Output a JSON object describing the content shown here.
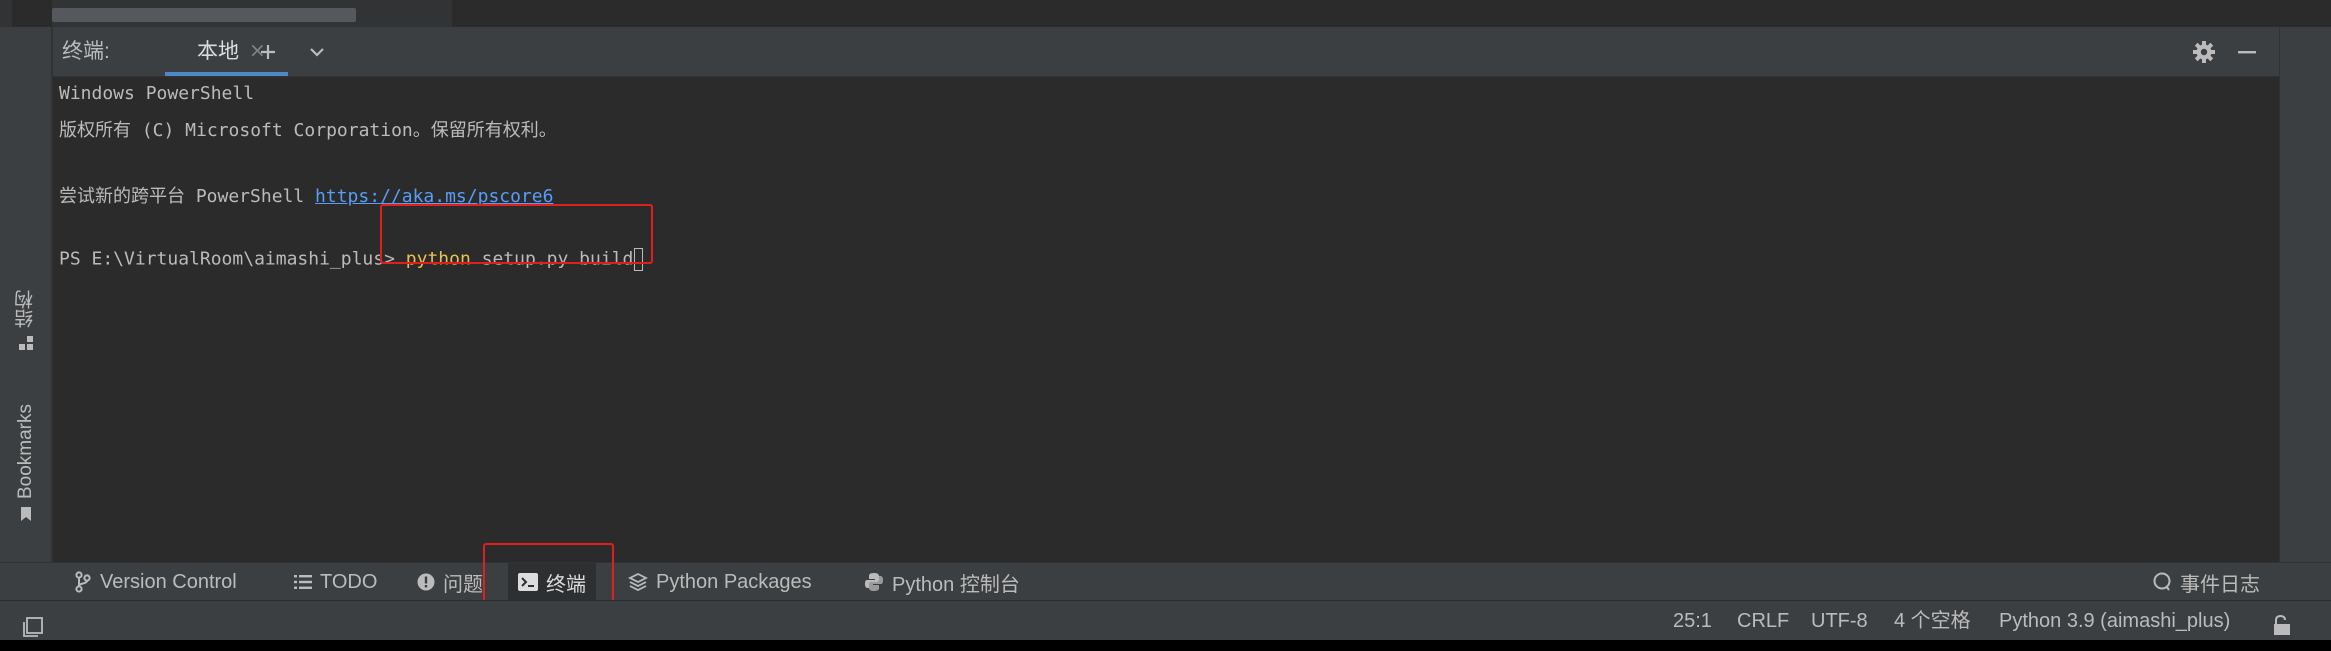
{
  "terminal": {
    "title": "终端:",
    "tab_label": "本地",
    "tab_close": "×",
    "lines": {
      "l1": "Windows PowerShell",
      "l2": "版权所有 (C) Microsoft Corporation。保留所有权利。",
      "l3_prefix": "尝试新的跨平台 PowerShell ",
      "l3_link": "https://aka.ms/pscore6",
      "prompt": "PS E:\\VirtualRoom\\aimashi_plus> ",
      "cmd_keyword": "python",
      "cmd_rest": " setup.py build"
    }
  },
  "left_stripe": {
    "structure_label": "结构",
    "bookmarks_label": "Bookmarks"
  },
  "tool_windows": {
    "version_control": "Version Control",
    "todo": "TODO",
    "problems": "问题",
    "terminal": "终端",
    "python_packages": "Python Packages",
    "python_console": "Python 控制台",
    "event_log": "事件日志"
  },
  "status": {
    "position": "25:1",
    "line_sep": "CRLF",
    "encoding": "UTF-8",
    "indent": "4 个空格",
    "interpreter": "Python 3.9 (aimashi_plus)"
  },
  "icons": {
    "settings": "gear-icon",
    "hide": "minimize-icon",
    "new_tab": "plus-icon",
    "tab_menu": "chevron-down-icon"
  },
  "colors": {
    "highlight_box": "#e0201d",
    "link": "#589df6",
    "keyword": "#e8c153",
    "active_tab_underline": "#4a88c7"
  }
}
